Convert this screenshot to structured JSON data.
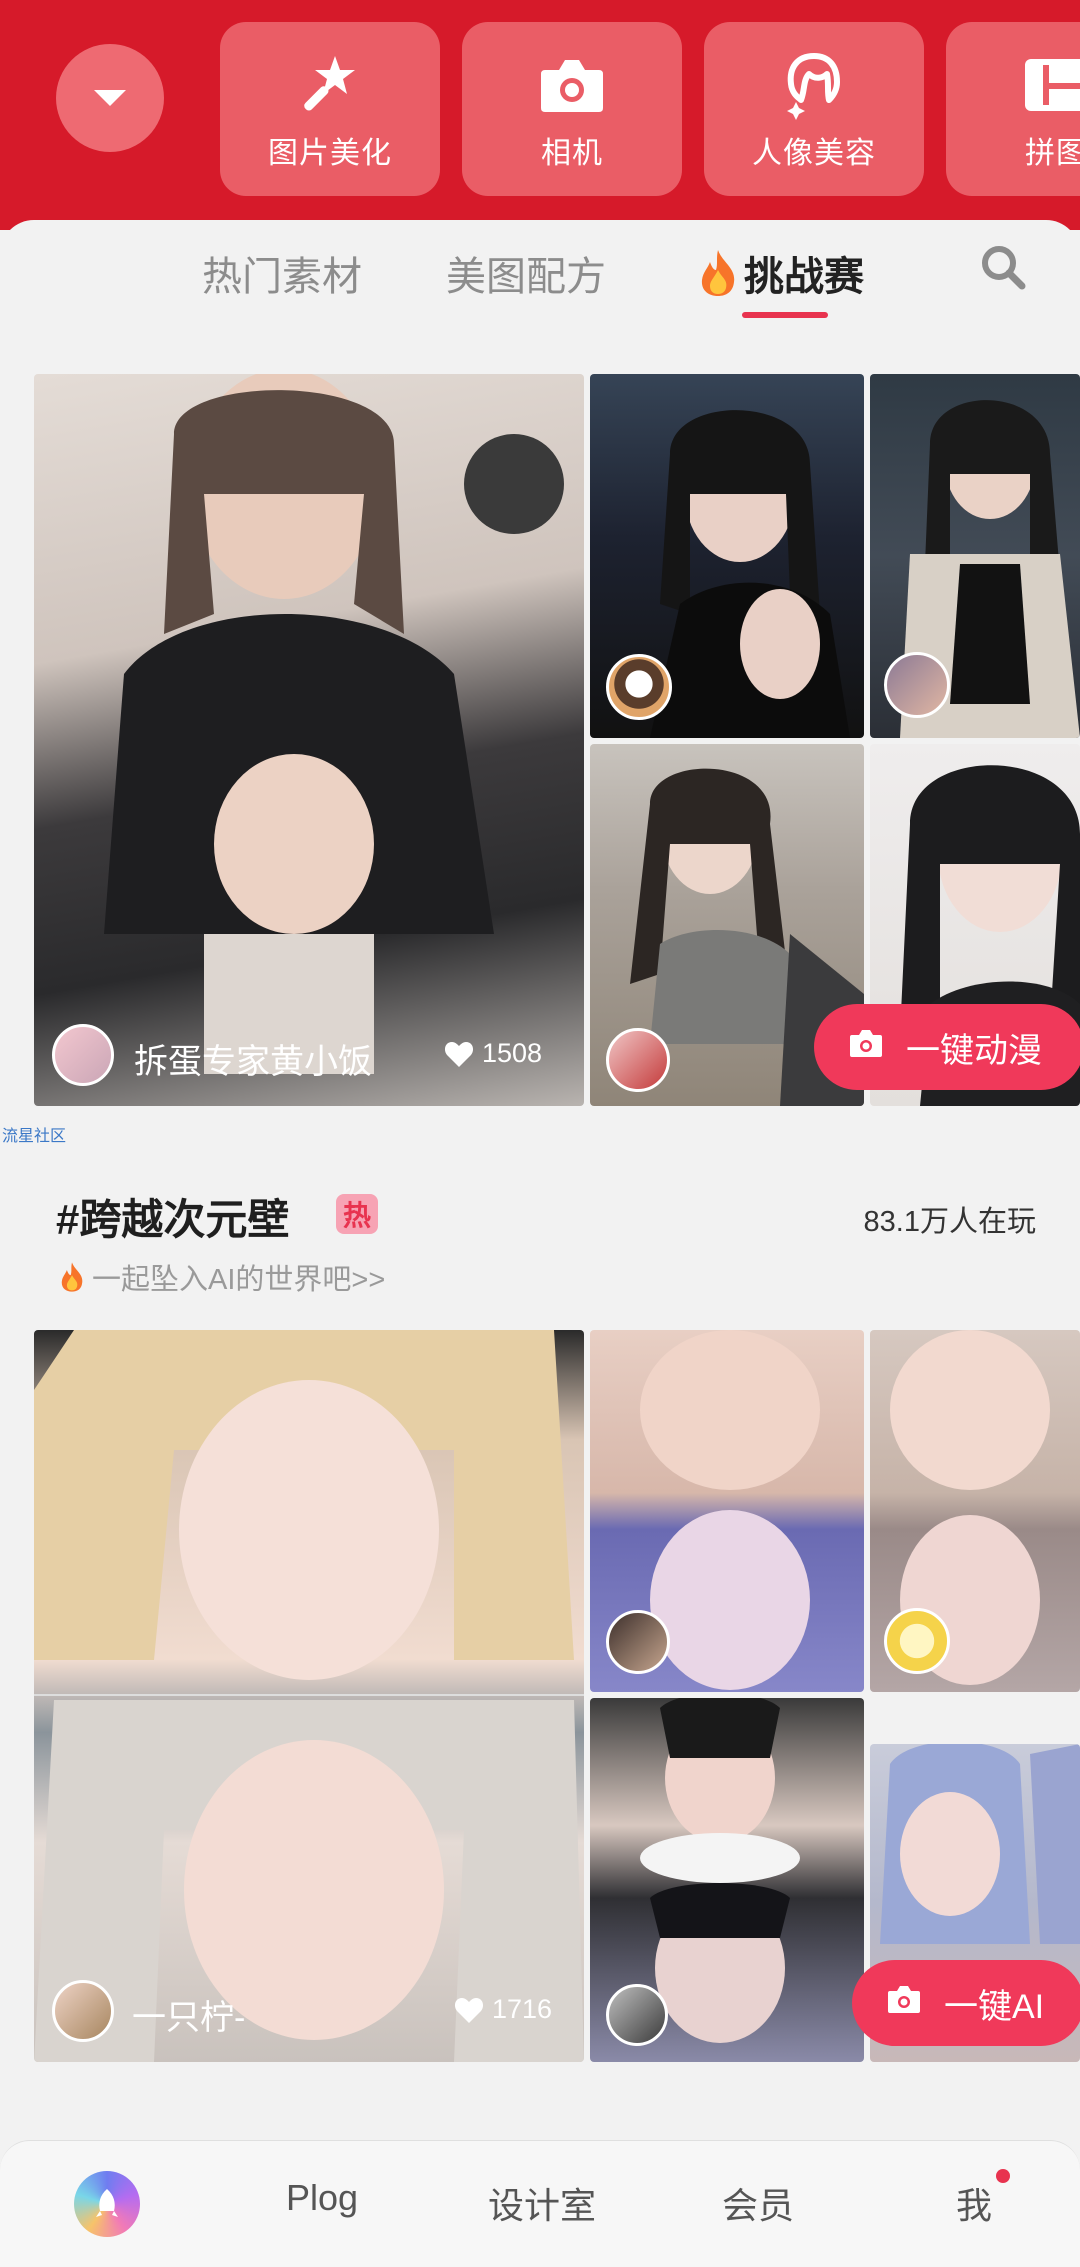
{
  "toolbar": {
    "tools": [
      {
        "label": "图片美化",
        "icon": "magic-wand-icon"
      },
      {
        "label": "相机",
        "icon": "camera-icon"
      },
      {
        "label": "人像美容",
        "icon": "portrait-icon"
      },
      {
        "label": "拼图",
        "icon": "collage-icon"
      }
    ]
  },
  "tabs": {
    "items": [
      {
        "label": "热门素材"
      },
      {
        "label": "美图配方"
      },
      {
        "label": "挑战赛"
      }
    ],
    "active": "挑战赛"
  },
  "challenge1": {
    "owner_name": "拆蛋专家黄小饭",
    "likes": "1508",
    "cta_label": "一键动漫"
  },
  "community_label": "流星社区",
  "challenge2": {
    "title": "#跨越次元壁",
    "hot_badge": "热",
    "players": "83.1万人在玩",
    "subtitle": "一起坠入AI的世界吧>>",
    "owner_name": "一只柠-",
    "likes": "1716",
    "cta_label": "一键AI"
  },
  "bottom_nav": {
    "items": [
      {
        "label": "Plog"
      },
      {
        "label": "设计室"
      },
      {
        "label": "会员"
      },
      {
        "label": "我"
      }
    ]
  },
  "colors": {
    "brand_red": "#d61a2a",
    "accent_pink": "#f0395a"
  }
}
